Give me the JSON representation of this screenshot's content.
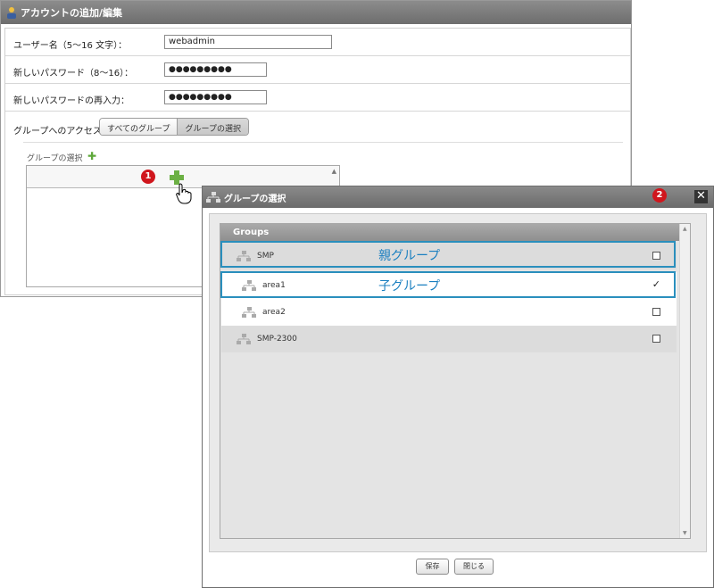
{
  "panel": {
    "title": "アカウントの追加/編集",
    "username_label": "ユーザー名（5～16 文字）：",
    "username_value": "webadmin",
    "password_label": "新しいパスワード（8～16）：",
    "password_value": "●●●●●●●●●",
    "password_confirm_label": "新しいパスワードの再入力：",
    "password_confirm_value": "●●●●●●●●●",
    "group_access_label": "グループへのアクセス",
    "group_access_options": [
      "すべてのグループ",
      "グループの選択"
    ],
    "group_access_selected": "グループの選択",
    "group_select_label": "グループの選択"
  },
  "markers": [
    "1",
    "2"
  ],
  "dialog": {
    "title": "グループの選択",
    "close_glyph": "✕",
    "tree_header": "Groups",
    "rows": [
      {
        "label": "SMP",
        "level": 0,
        "checked": false
      },
      {
        "label": "area1",
        "level": 1,
        "checked": true
      },
      {
        "label": "area2",
        "level": 1,
        "checked": false
      },
      {
        "label": "SMP-2300",
        "level": 0,
        "checked": false
      }
    ],
    "annotations": {
      "parent": "親グループ",
      "child": "子グループ"
    },
    "save_label": "保存",
    "close_label": "閉じる"
  },
  "colors": {
    "highlight": "#2a8fbd",
    "badge": "#d0161d",
    "plus": "#6cb044"
  }
}
